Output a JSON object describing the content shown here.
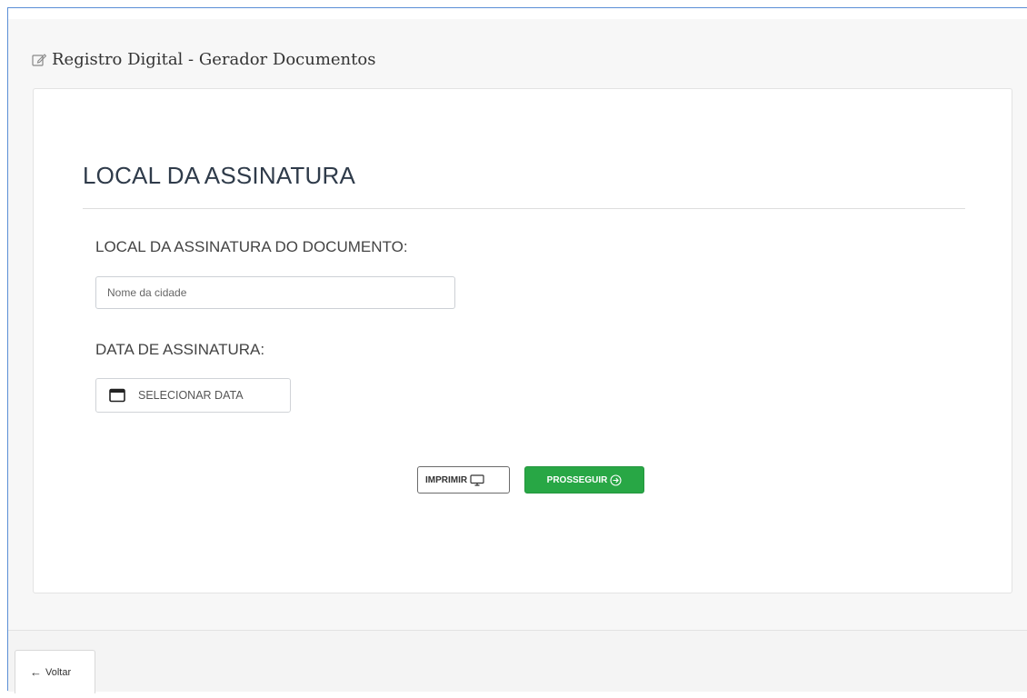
{
  "panel": {
    "title": "Registro Digital - Gerador Documentos",
    "icon": "edit-icon"
  },
  "section": {
    "title": "LOCAL DA ASSINATURA"
  },
  "form": {
    "local_label": "LOCAL DA ASSINATURA DO DOCUMENTO:",
    "city_value": "",
    "city_placeholder": "Nome da cidade",
    "date_label": "DATA DE ASSINATURA:",
    "date_button_label": "SELECIONAR DATA",
    "date_icon": "calendar-icon"
  },
  "actions": {
    "print_label": "IMPRIMIR",
    "print_icon": "monitor-icon",
    "next_label": "PROSSEGUIR",
    "next_icon": "circle-arrow-right-icon",
    "next_color": "#28a745"
  },
  "footer": {
    "back_label": "Voltar",
    "back_icon": "arrow-left-icon"
  }
}
